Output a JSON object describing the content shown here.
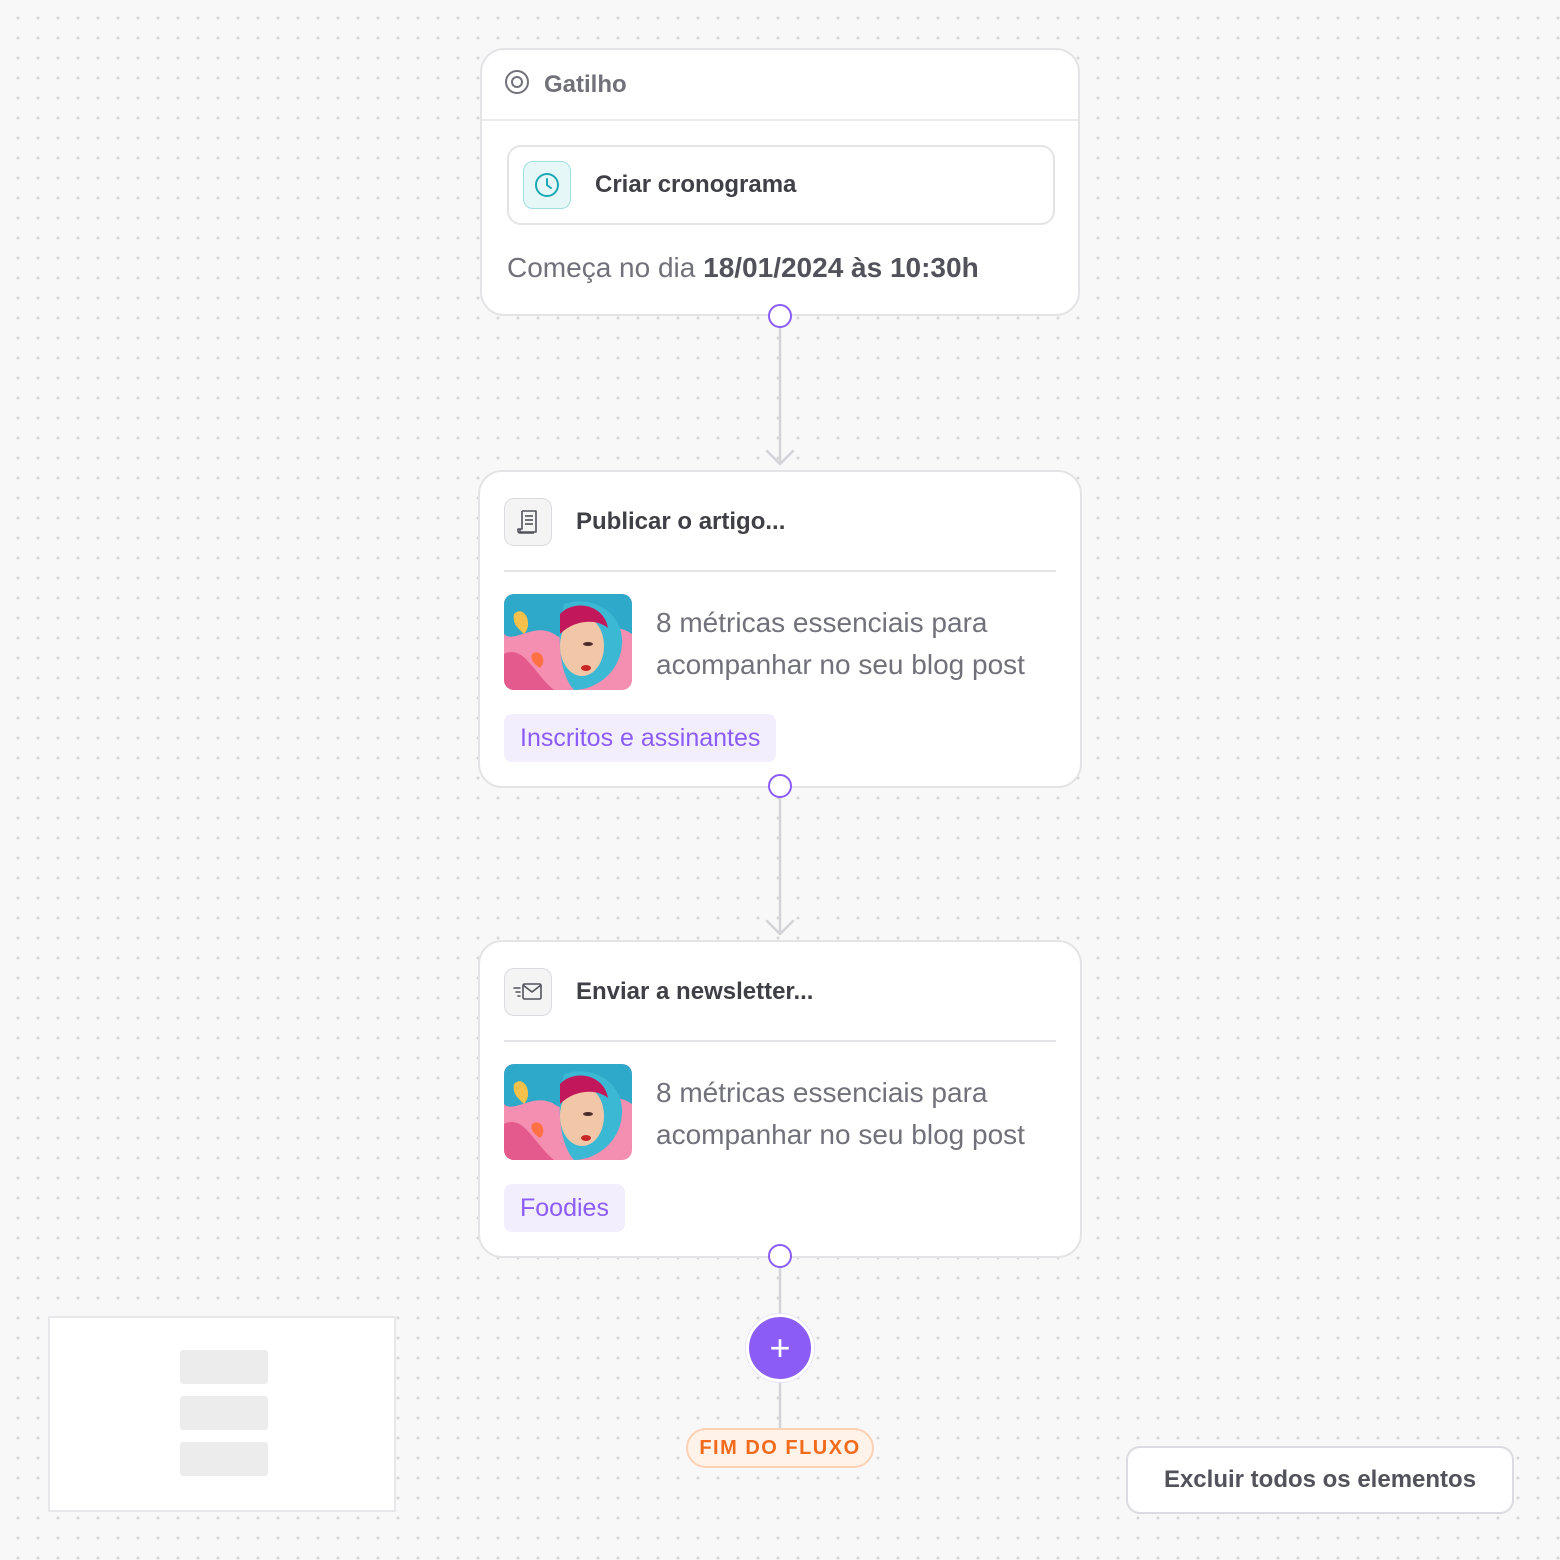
{
  "trigger": {
    "header_label": "Gatilho",
    "schedule_label": "Criar cronograma",
    "starts_prefix": "Começa no dia",
    "starts_datetime": "18/01/2024 às 10:30h"
  },
  "actions": [
    {
      "title": "Publicar o artigo...",
      "icon": "article-icon",
      "post_title": "8 métricas essenciais para acompanhar no seu blog post",
      "tag": "Inscritos e assinantes"
    },
    {
      "title": "Enviar a newsletter...",
      "icon": "send-mail-icon",
      "post_title": "8 métricas essenciais para acompanhar no seu blog post",
      "tag": "Foodies"
    }
  ],
  "flow_end": {
    "add_button": "+",
    "end_label": "FIM DO FLUXO"
  },
  "toolbar": {
    "delete_all_label": "Excluir todos os elementos"
  },
  "colors": {
    "accent": "#8b5cf6",
    "end_badge": "#f26b1d",
    "clock_icon": "#1ba8b3"
  }
}
